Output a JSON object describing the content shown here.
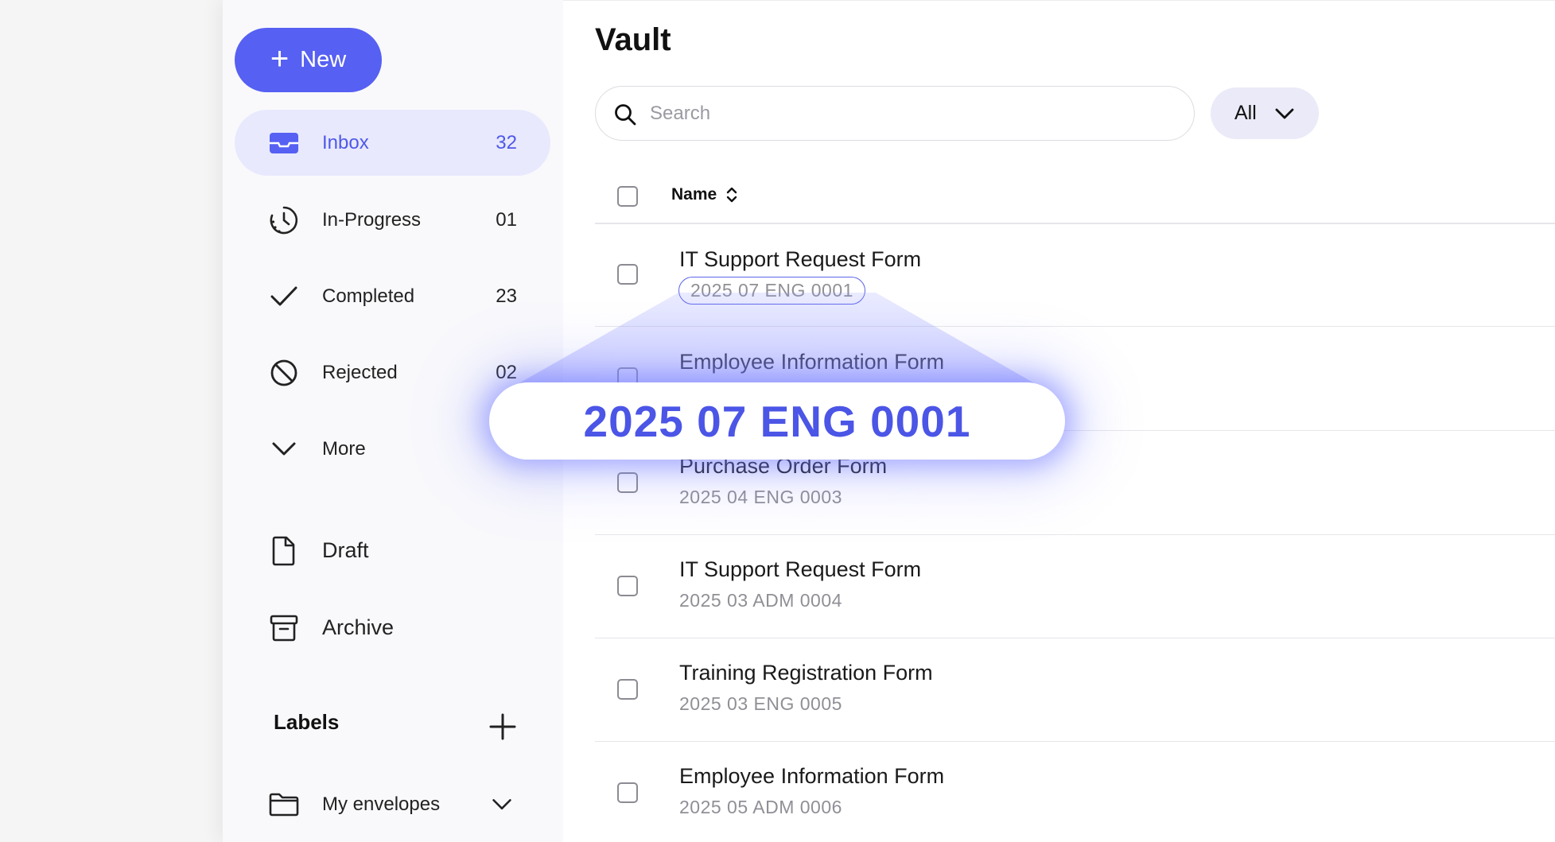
{
  "sidebar": {
    "new_label": "New",
    "items": [
      {
        "label": "Inbox",
        "count": "32",
        "icon": "inbox-icon"
      },
      {
        "label": "In-Progress",
        "count": "01",
        "icon": "clock-icon"
      },
      {
        "label": "Completed",
        "count": "23",
        "icon": "check-icon"
      },
      {
        "label": "Rejected",
        "count": "02",
        "icon": "ban-icon"
      },
      {
        "label": "More",
        "icon": "chevron-down-icon"
      },
      {
        "label": "Draft",
        "icon": "file-icon"
      },
      {
        "label": "Archive",
        "icon": "archive-icon"
      }
    ],
    "labels_heading": "Labels",
    "my_envelopes": "My envelopes"
  },
  "main": {
    "title": "Vault",
    "search": {
      "placeholder": "Search"
    },
    "filter": {
      "selected": "All"
    },
    "table": {
      "column_name": "Name",
      "rows": [
        {
          "title": "IT Support Request Form",
          "code": "2025 07 ENG 0001"
        },
        {
          "title": "Employee Information Form",
          "code": ""
        },
        {
          "title": "Purchase Order Form",
          "code": "2025 04 ENG 0003"
        },
        {
          "title": "IT Support Request Form",
          "code": "2025 03 ADM 0004"
        },
        {
          "title": "Training Registration Form",
          "code": "2025 03 ENG 0005"
        },
        {
          "title": "Employee Information Form",
          "code": "2025 05 ADM 0006"
        }
      ]
    }
  },
  "zoom": {
    "text": "2025 07 ENG 0001"
  },
  "colors": {
    "accent": "#5660f2",
    "active_bg": "#e8e9fd"
  }
}
